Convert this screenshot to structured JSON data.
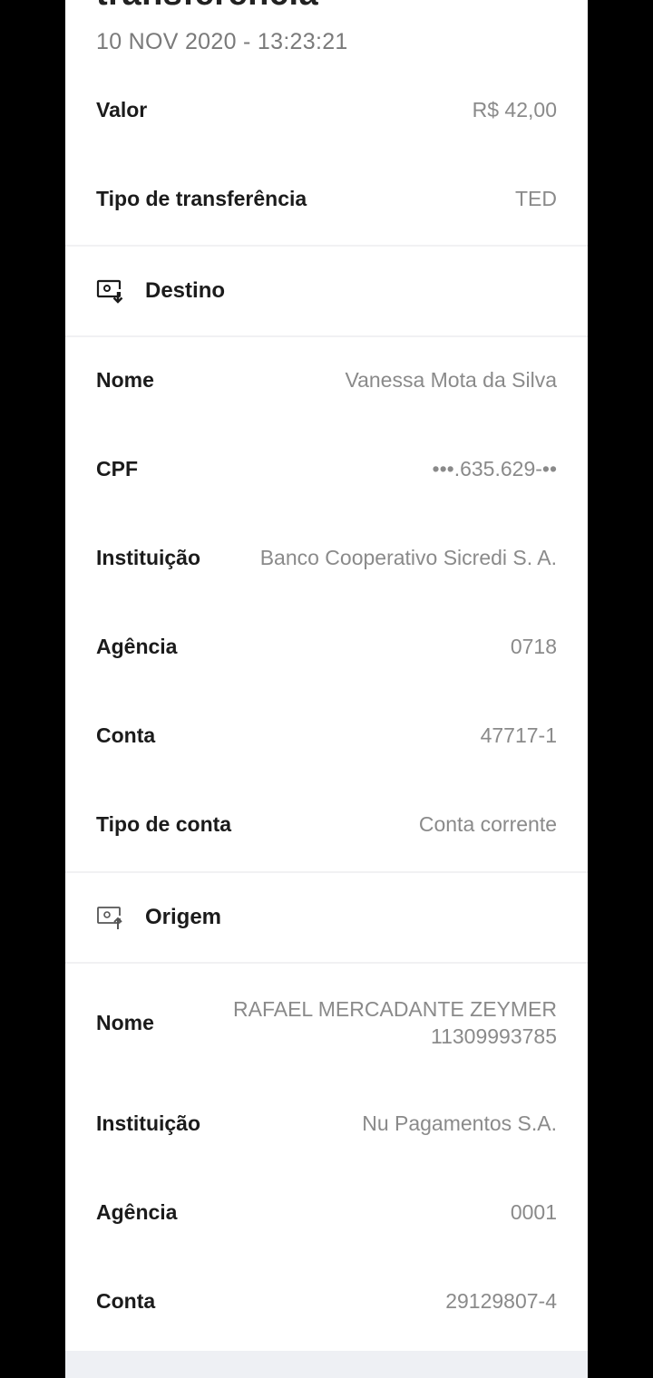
{
  "header": {
    "title": "transferência",
    "date": "10 NOV 2020 - 13:23:21"
  },
  "summary": [
    {
      "label": "Valor",
      "value": "R$ 42,00"
    },
    {
      "label": "Tipo de transferência",
      "value": "TED"
    }
  ],
  "destino": {
    "title": "Destino",
    "icon": "receive-icon",
    "rows": [
      {
        "label": "Nome",
        "value": "Vanessa Mota da Silva"
      },
      {
        "label": "CPF",
        "value": "•••.635.629-••"
      },
      {
        "label": "Instituição",
        "value": "Banco Cooperativo Sicredi S. A."
      },
      {
        "label": "Agência",
        "value": "0718"
      },
      {
        "label": "Conta",
        "value": "47717-1"
      },
      {
        "label": "Tipo de conta",
        "value": "Conta corrente"
      }
    ]
  },
  "origem": {
    "title": "Origem",
    "icon": "send-icon",
    "rows": [
      {
        "label": "Nome",
        "value": "RAFAEL MERCADANTE ZEYMER 11309993785"
      },
      {
        "label": "Instituição",
        "value": "Nu Pagamentos S.A."
      },
      {
        "label": "Agência",
        "value": "0001"
      },
      {
        "label": "Conta",
        "value": "29129807-4"
      }
    ]
  }
}
